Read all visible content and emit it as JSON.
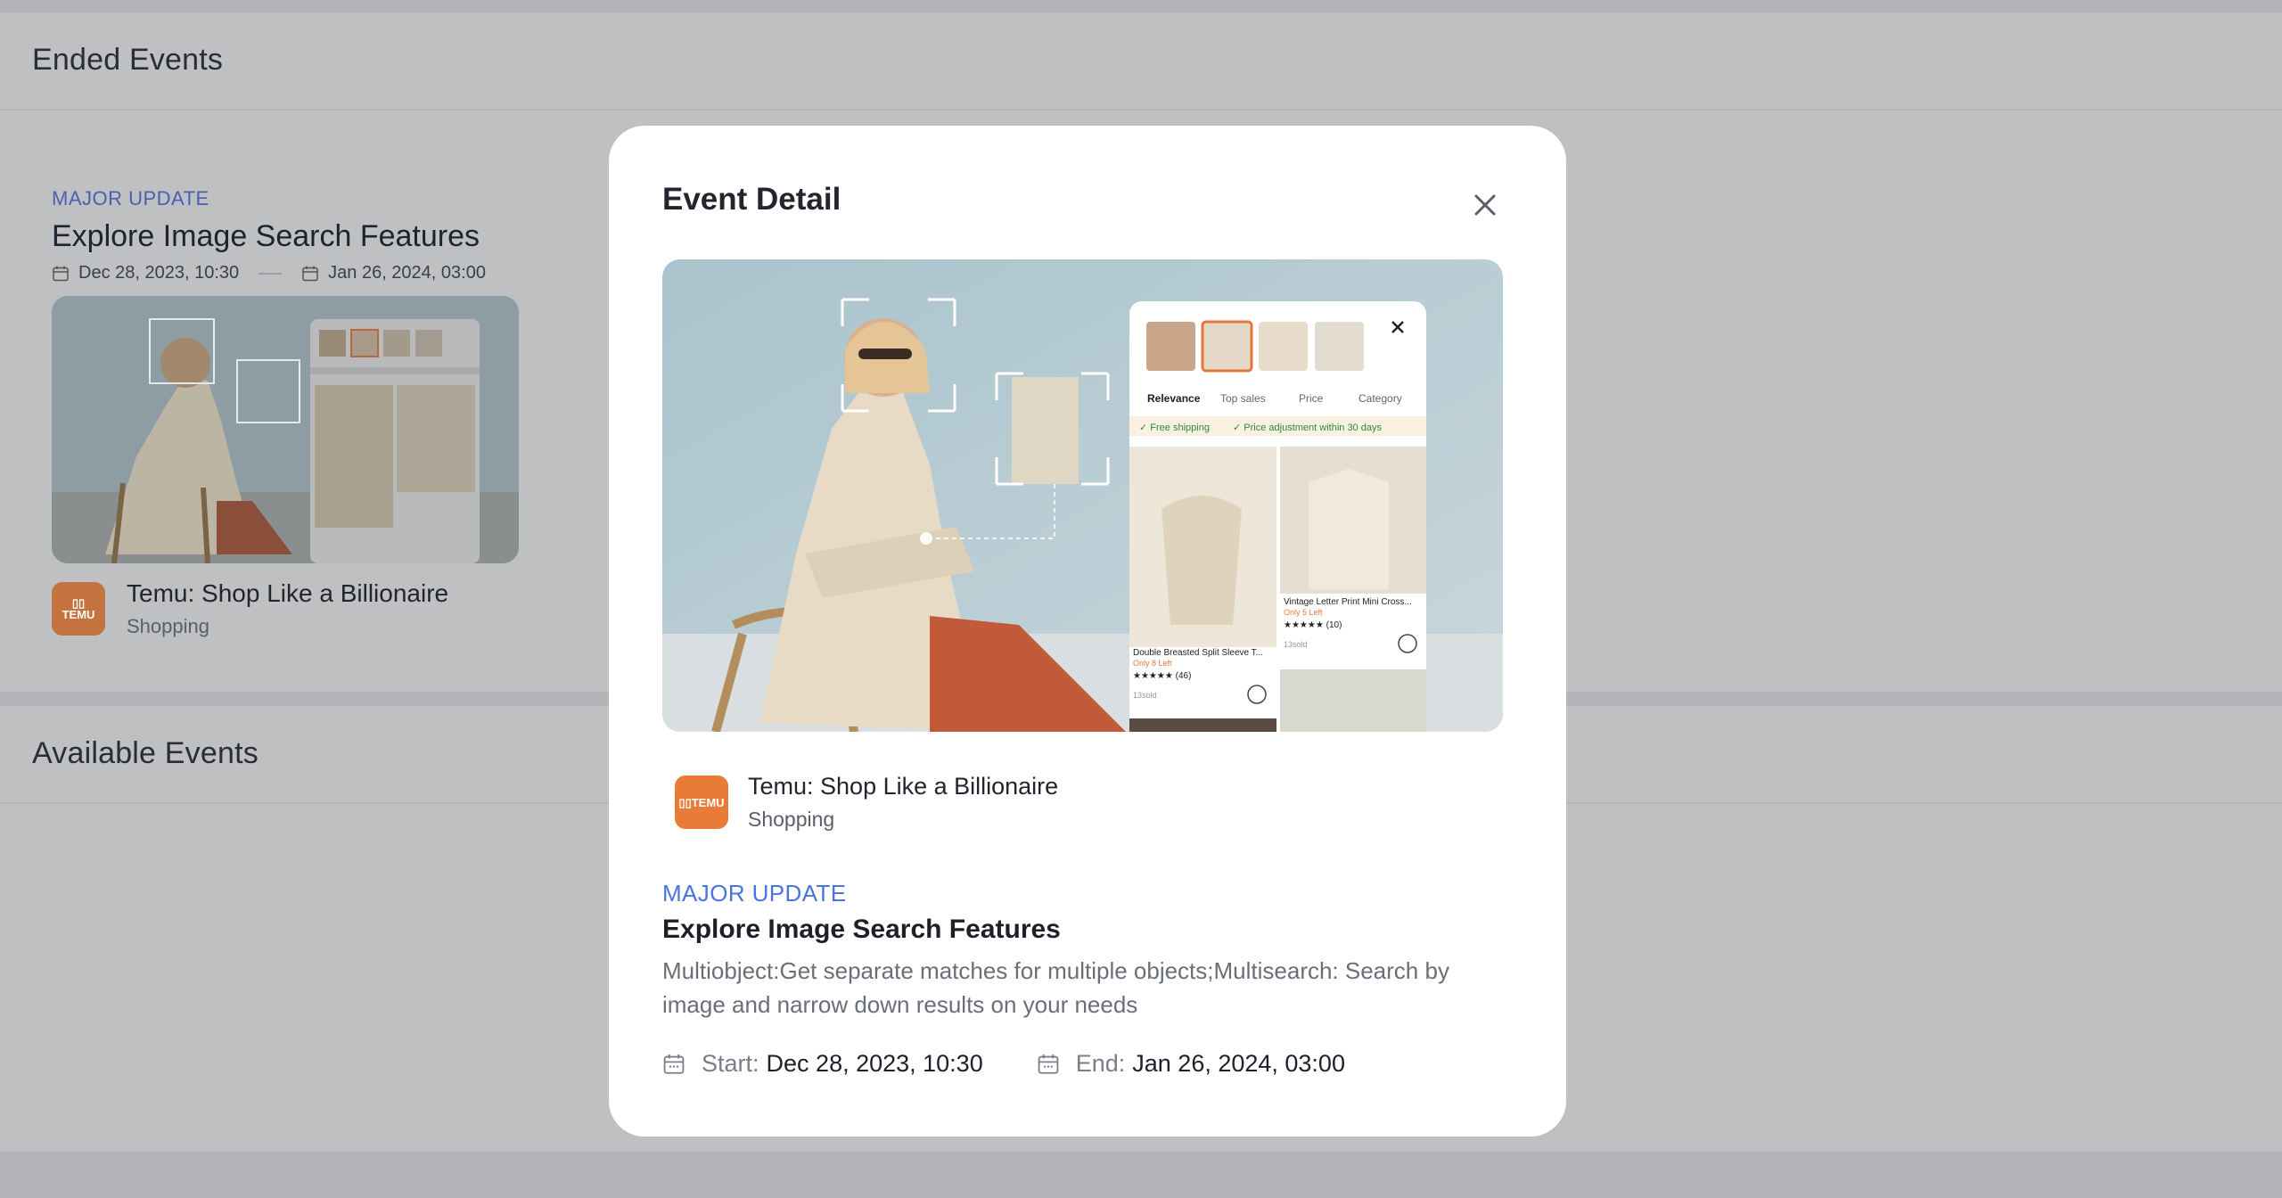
{
  "background": {
    "ended_section_title": "Ended Events",
    "available_section_title": "Available Events",
    "card": {
      "tag": "MAJOR UPDATE",
      "title": "Explore Image Search Features",
      "start_date": "Dec 28, 2023, 10:30",
      "end_date": "Jan 26, 2024, 03:00",
      "app_name": "Temu: Shop Like a Billionaire",
      "app_category": "Shopping"
    }
  },
  "modal": {
    "title": "Event Detail",
    "app_name": "Temu: Shop Like a Billionaire",
    "app_category": "Shopping",
    "app_icon_text": "TEMU",
    "tag": "MAJOR UPDATE",
    "event_title": "Explore Image Search Features",
    "description": "Multiobject:Get separate matches for multiple objects;Multisearch: Search by image and narrow down results on your needs",
    "start_label": "Start:",
    "start_value": "Dec 28, 2023, 10:30",
    "end_label": "End:",
    "end_value": "Jan 26, 2024, 03:00"
  },
  "hero_image": {
    "filters": [
      "Relevance",
      "Top sales",
      "Price",
      "Category"
    ],
    "badges": [
      "Free shipping",
      "Price adjustment within 30 days"
    ],
    "product_1": {
      "name": "Double Breasted Split Sleeve T...",
      "stock": "Only 8 Left",
      "reviews": "(46)",
      "sold": "13sold"
    },
    "product_2": {
      "name": "Vintage Letter Print Mini Cross...",
      "stock": "Only 5 Left",
      "reviews": "(10)",
      "sold": "13sold"
    }
  },
  "colors": {
    "accent": "#4a74e0",
    "temu_orange": "#e87b35",
    "overlay_bg": "#bfc0c2"
  }
}
